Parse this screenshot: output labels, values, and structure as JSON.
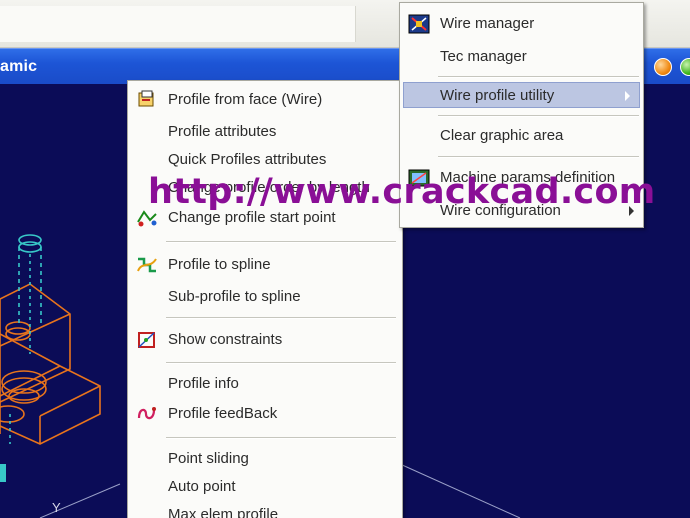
{
  "window": {
    "title_fragment": "amic"
  },
  "main_menu": {
    "items": [
      {
        "label": "Profile from face (Wire)",
        "icon": "profile-face-icon"
      },
      {
        "label": "Profile attributes"
      },
      {
        "label": "Quick Profiles attributes"
      },
      {
        "label": "Change profile order by length"
      },
      {
        "label": "Change profile start point",
        "icon": "start-point-icon"
      },
      {
        "label": "Profile to spline",
        "icon": "spline-icon"
      },
      {
        "label": "Sub-profile to spline"
      },
      {
        "label": "Show constraints",
        "icon": "constraints-icon"
      },
      {
        "label": "Profile info"
      },
      {
        "label": "Profile feedBack",
        "icon": "feedback-icon"
      },
      {
        "label": "Point sliding"
      },
      {
        "label": "Auto point"
      },
      {
        "label": "Max elem profile"
      }
    ]
  },
  "sub_menu": {
    "items": [
      {
        "label": "Wire manager",
        "icon": "wire-manager-icon"
      },
      {
        "label": "Tec manager"
      },
      {
        "label": "Wire profile utility",
        "highlighted": true
      },
      {
        "label": "Clear graphic area"
      },
      {
        "label": "Machine params definition",
        "icon": "machine-params-icon"
      },
      {
        "label": "Wire configuration"
      }
    ]
  },
  "watermark": {
    "text": "http://www.crackcad.com"
  },
  "viewport": {
    "axis_label": "Y"
  },
  "colors": {
    "viewport_bg": "#0b0c57",
    "cad_orange": "#e8741c",
    "cad_cyan": "#38c8c8",
    "watermark": "#8a0f96",
    "title_blue": "#1d55d6"
  }
}
